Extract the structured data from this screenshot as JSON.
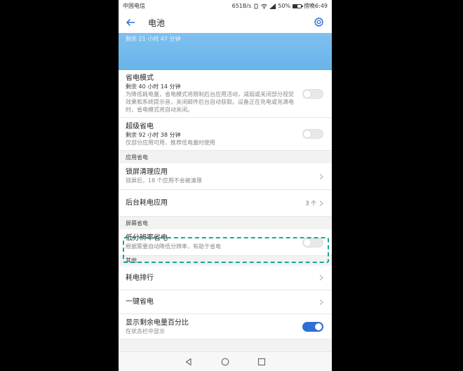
{
  "status_bar": {
    "carrier": "中国电信",
    "speed": "651B/s",
    "battery_pct": "50%",
    "time": "傍晚6:49",
    "battery_level": 0.5
  },
  "app_bar": {
    "title": "电池"
  },
  "hero": {
    "remaining": "剩余 21 小时 47 分钟"
  },
  "items": {
    "power_saving": {
      "title": "省电模式",
      "subtitle": "剩余 40 小时 14 分钟",
      "desc": "为降低耗电量，省电模式将限制后台应用活动，减弱或关闭部分视觉效果和系统提示音，关闭邮件后台自动获取。设备正在充电或充满电时，省电模式将自动关闭。"
    },
    "ultra_saving": {
      "title": "超级省电",
      "subtitle": "剩余 92 小时 38 分钟",
      "desc": "仅部分应用可用，推荐低电量时使用"
    },
    "lock_screen_clean": {
      "title": "锁屏清理应用",
      "desc": "锁屏后，18 个应用不会被清理"
    },
    "background_apps": {
      "title": "后台耗电应用",
      "count": "3 个"
    },
    "low_resolution": {
      "title": "低分辨率省电",
      "desc": "根据需要自动降低分辨率，有助于省电"
    },
    "ranking": {
      "title": "耗电排行"
    },
    "one_key": {
      "title": "一键省电"
    },
    "show_percentage": {
      "title": "显示剩余电量百分比",
      "desc": "在状态栏中显示"
    }
  },
  "sections": {
    "app_saving": "应用省电",
    "screen_saving": "屏幕省电",
    "other": "其他"
  },
  "colors": {
    "accent": "#2e6fd4",
    "hero": "#6fb7ec",
    "highlight": "#16a89a"
  }
}
